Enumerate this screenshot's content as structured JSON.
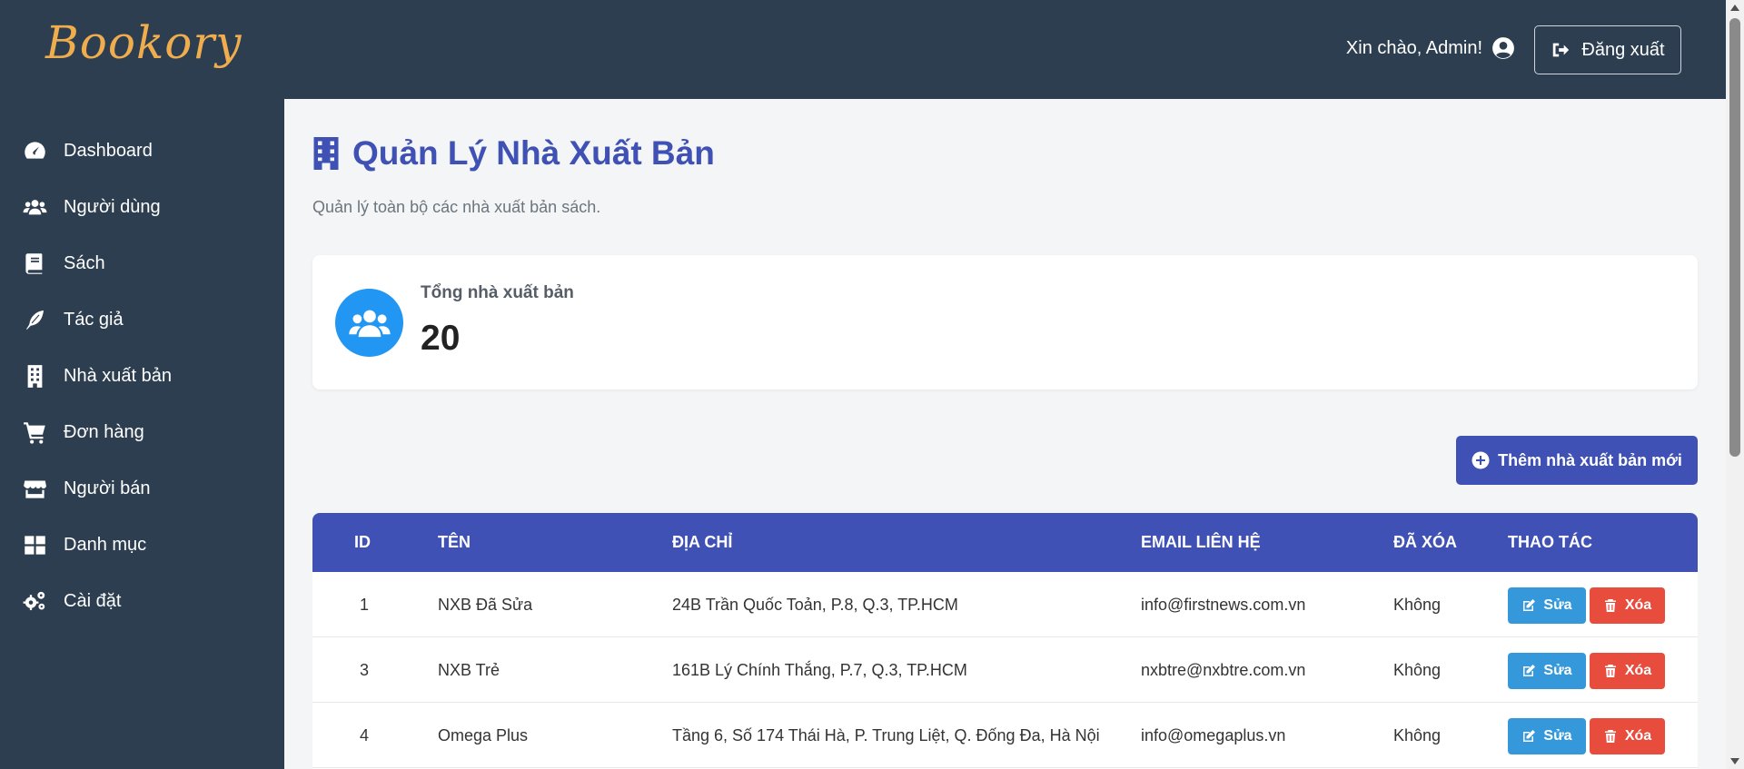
{
  "app": {
    "logo": "Bookory"
  },
  "header": {
    "greeting": "Xin chào, Admin!",
    "logout_label": "Đăng xuất"
  },
  "sidebar": {
    "items": [
      {
        "label": "Dashboard",
        "icon": "gauge-icon"
      },
      {
        "label": "Người dùng",
        "icon": "users-icon"
      },
      {
        "label": "Sách",
        "icon": "book-icon"
      },
      {
        "label": "Tác giả",
        "icon": "feather-icon"
      },
      {
        "label": "Nhà xuất bản",
        "icon": "building-icon"
      },
      {
        "label": "Đơn hàng",
        "icon": "cart-icon"
      },
      {
        "label": "Người bán",
        "icon": "store-icon"
      },
      {
        "label": "Danh mục",
        "icon": "grid-icon"
      },
      {
        "label": "Cài đặt",
        "icon": "gears-icon"
      }
    ]
  },
  "main": {
    "title": "Quản Lý Nhà Xuất Bản",
    "subtitle": "Quản lý toàn bộ các nhà xuất bản sách.",
    "stat": {
      "label": "Tổng nhà xuất bản",
      "value": "20"
    },
    "add_button": "Thêm nhà xuất bản mới"
  },
  "table": {
    "headers": [
      "ID",
      "TÊN",
      "ĐỊA CHỈ",
      "EMAIL LIÊN HỆ",
      "ĐÃ XÓA",
      "THAO TÁC"
    ],
    "rows": [
      {
        "id": "1",
        "name": "NXB Đã Sửa",
        "address": "24B Trần Quốc Toản, P.8, Q.3, TP.HCM",
        "email": "info@firstnews.com.vn",
        "deleted": "Không"
      },
      {
        "id": "3",
        "name": "NXB Trẻ",
        "address": "161B Lý Chính Thắng, P.7, Q.3, TP.HCM",
        "email": "nxbtre@nxbtre.com.vn",
        "deleted": "Không"
      },
      {
        "id": "4",
        "name": "Omega Plus",
        "address": "Tầng 6, Số 174 Thái Hà, P. Trung Liệt, Q. Đống Đa, Hà Nội",
        "email": "info@omegaplus.vn",
        "deleted": "Không"
      }
    ],
    "edit_label": "Sửa",
    "delete_label": "Xóa"
  },
  "colors": {
    "header_bg": "#2d3e50",
    "accent": "#3f51b5",
    "logo": "#f0ad4e",
    "stat_circle": "#2196f3",
    "edit": "#3498db",
    "delete": "#e74c3c"
  }
}
